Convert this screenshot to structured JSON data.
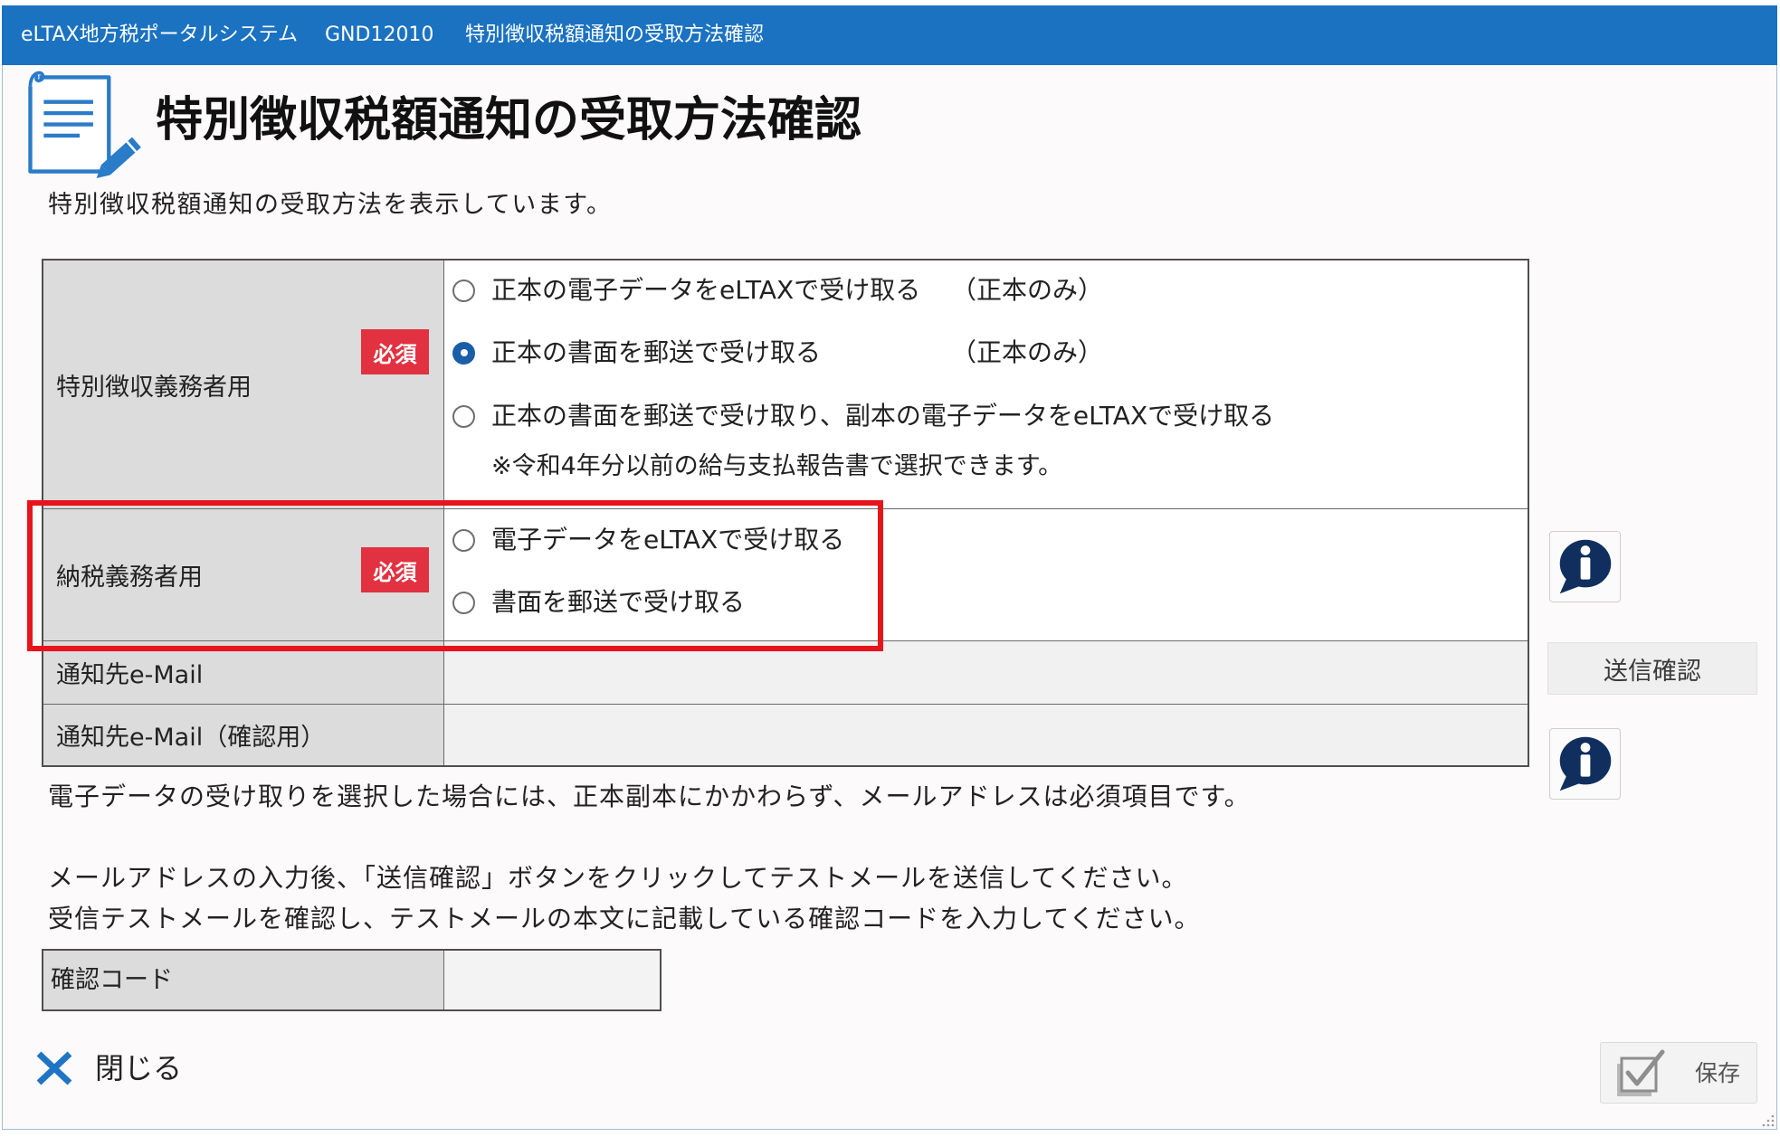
{
  "window": {
    "app_name": "eLTAX地方税ポータルシステム",
    "screen_id": "GND12010",
    "screen_title": "特別徴収税額通知の受取方法確認"
  },
  "header": {
    "icon": "document-edit-icon",
    "title": "特別徴収税額通知の受取方法確認",
    "description": "特別徴収税額通知の受取方法を表示しています。"
  },
  "form": {
    "required_label": "必須",
    "special_collector": {
      "label": "特別徴収義務者用",
      "options": [
        {
          "text": "正本の電子データをeLTAXで受け取る",
          "suffix": "（正本のみ）",
          "selected": false
        },
        {
          "text": "正本の書面を郵送で受け取る",
          "suffix": "（正本のみ）",
          "selected": true
        },
        {
          "text": "正本の書面を郵送で受け取り、副本の電子データをeLTAXで受け取る",
          "selected": false
        }
      ],
      "note": "※令和4年分以前の給与支払報告書で選択できます。"
    },
    "taxpayer": {
      "label": "納税義務者用",
      "options": [
        {
          "text": "電子データをeLTAXで受け取る",
          "selected": false
        },
        {
          "text": "書面を郵送で受け取る",
          "selected": false
        }
      ]
    },
    "email": {
      "label": "通知先e-Mail",
      "value": ""
    },
    "email_confirm": {
      "label": "通知先e-Mail（確認用）",
      "value": ""
    }
  },
  "send_confirm_button": "送信確認",
  "notes": [
    "電子データの受け取りを選択した場合には、正本副本にかかわらず、メールアドレスは必須項目です。",
    "メールアドレスの入力後、「送信確認」ボタンをクリックしてテストメールを送信してください。",
    "受信テストメールを確認し、テストメールの本文に記載している確認コードを入力してください。"
  ],
  "confirm_code": {
    "label": "確認コード",
    "value": ""
  },
  "footer": {
    "close_label": "閉じる",
    "save_label": "保存"
  },
  "icons": {
    "info": "info-icon",
    "close": "close-icon",
    "save": "save-check-icon",
    "resize": "resize-grip-icon"
  },
  "colors": {
    "title_bar": "#1b72c1",
    "accent": "#1f75c4",
    "required_badge": "#e23140",
    "highlight_box": "#e8141c",
    "info_icon": "#112f5e",
    "label_cell": "#dcdcdc"
  }
}
